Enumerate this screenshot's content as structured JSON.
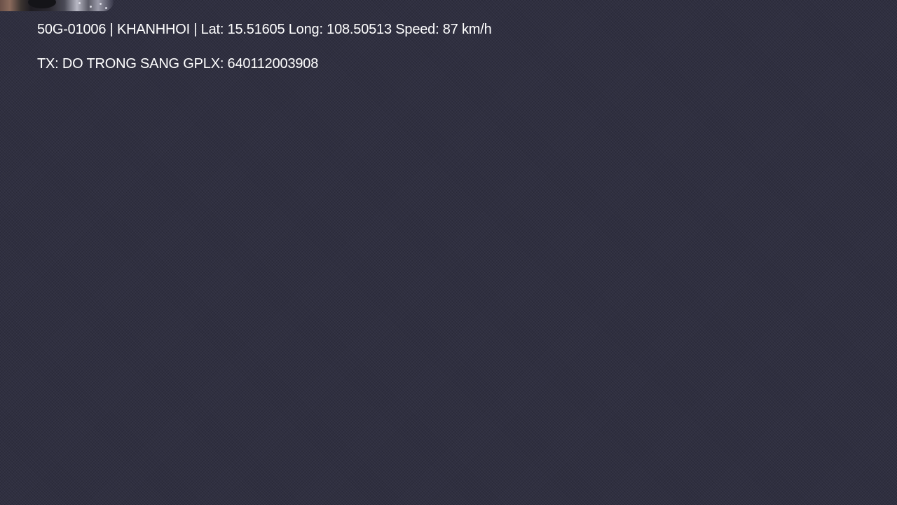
{
  "overlay": {
    "vehicle_line": "50G-01006 | KHANHHOI | Lat: 15.51605 Long: 108.50513 Speed: 87 km/h",
    "driver_line": "TX: DO TRONG SANG GPLX: 640112003908"
  },
  "colors": {
    "background": "#2f2f40",
    "text": "#ffffff"
  }
}
